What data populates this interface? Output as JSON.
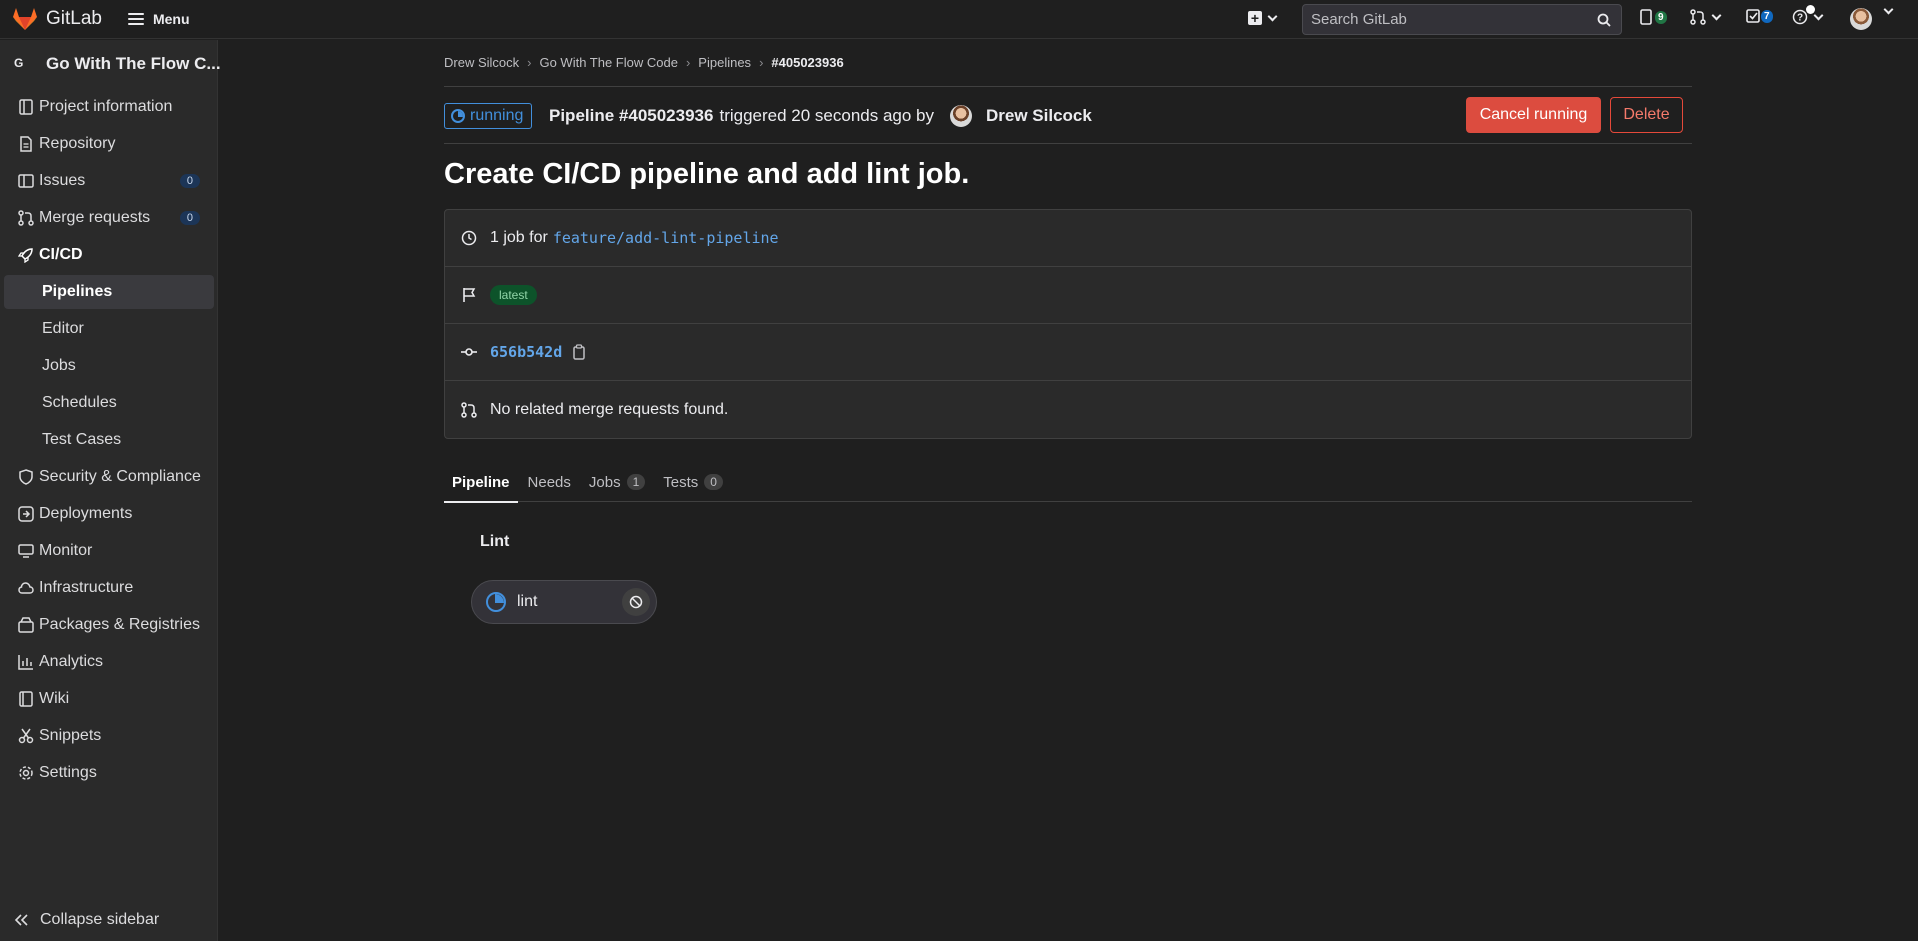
{
  "topbar": {
    "brand": "GitLab",
    "menu_label": "Menu",
    "search_placeholder": "Search GitLab",
    "issues_count": "9",
    "todos_count": "7"
  },
  "sidebar": {
    "project_initial": "G",
    "project_name": "Go With The Flow C...",
    "items": [
      {
        "label": "Project information",
        "icon": "info-icon"
      },
      {
        "label": "Repository",
        "icon": "doc-icon"
      },
      {
        "label": "Issues",
        "icon": "issues-icon",
        "count": "0"
      },
      {
        "label": "Merge requests",
        "icon": "merge-request-icon",
        "count": "0"
      },
      {
        "label": "CI/CD",
        "icon": "rocket-icon"
      }
    ],
    "cicd_sub": [
      "Pipelines",
      "Editor",
      "Jobs",
      "Schedules",
      "Test Cases"
    ],
    "items_after": [
      {
        "label": "Security & Compliance",
        "icon": "shield-icon"
      },
      {
        "label": "Deployments",
        "icon": "deploy-icon"
      },
      {
        "label": "Monitor",
        "icon": "monitor-icon"
      },
      {
        "label": "Infrastructure",
        "icon": "cloud-icon"
      },
      {
        "label": "Packages & Registries",
        "icon": "package-icon"
      },
      {
        "label": "Analytics",
        "icon": "chart-icon"
      },
      {
        "label": "Wiki",
        "icon": "book-icon"
      },
      {
        "label": "Snippets",
        "icon": "scissors-icon"
      },
      {
        "label": "Settings",
        "icon": "gear-icon"
      }
    ],
    "collapse_label": "Collapse sidebar"
  },
  "breadcrumb": [
    "Drew Silcock",
    "Go With The Flow Code",
    "Pipelines",
    "#405023936"
  ],
  "pipeline": {
    "status": "running",
    "name": "Pipeline #405023936",
    "triggered_text": "triggered 20 seconds ago by",
    "user": "Drew Silcock",
    "cancel_label": "Cancel running",
    "delete_label": "Delete",
    "title": "Create CI/CD pipeline and add lint job.",
    "jobs_text": "1 job for",
    "branch": "feature/add-lint-pipeline",
    "badge": "latest",
    "commit_sha": "656b542d",
    "mr_text": "No related merge requests found."
  },
  "tabs": [
    {
      "label": "Pipeline",
      "count": null
    },
    {
      "label": "Needs",
      "count": null
    },
    {
      "label": "Jobs",
      "count": "1"
    },
    {
      "label": "Tests",
      "count": "0"
    }
  ],
  "stage": {
    "name": "Lint",
    "job_name": "lint"
  },
  "colors": {
    "accent_blue": "#428fdc",
    "danger": "#dc4c3f",
    "success_badge": "#0d532a"
  }
}
